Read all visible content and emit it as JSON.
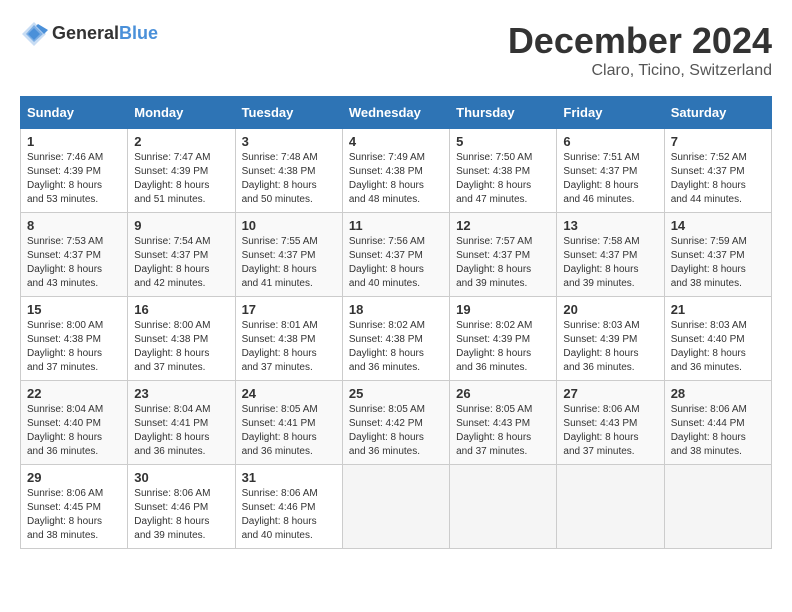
{
  "logo": {
    "general": "General",
    "blue": "Blue"
  },
  "title": "December 2024",
  "location": "Claro, Ticino, Switzerland",
  "days_header": [
    "Sunday",
    "Monday",
    "Tuesday",
    "Wednesday",
    "Thursday",
    "Friday",
    "Saturday"
  ],
  "weeks": [
    [
      {
        "num": "1",
        "sunrise": "7:46 AM",
        "sunset": "4:39 PM",
        "daylight": "8 hours and 53 minutes."
      },
      {
        "num": "2",
        "sunrise": "7:47 AM",
        "sunset": "4:39 PM",
        "daylight": "8 hours and 51 minutes."
      },
      {
        "num": "3",
        "sunrise": "7:48 AM",
        "sunset": "4:38 PM",
        "daylight": "8 hours and 50 minutes."
      },
      {
        "num": "4",
        "sunrise": "7:49 AM",
        "sunset": "4:38 PM",
        "daylight": "8 hours and 48 minutes."
      },
      {
        "num": "5",
        "sunrise": "7:50 AM",
        "sunset": "4:38 PM",
        "daylight": "8 hours and 47 minutes."
      },
      {
        "num": "6",
        "sunrise": "7:51 AM",
        "sunset": "4:37 PM",
        "daylight": "8 hours and 46 minutes."
      },
      {
        "num": "7",
        "sunrise": "7:52 AM",
        "sunset": "4:37 PM",
        "daylight": "8 hours and 44 minutes."
      }
    ],
    [
      {
        "num": "8",
        "sunrise": "7:53 AM",
        "sunset": "4:37 PM",
        "daylight": "8 hours and 43 minutes."
      },
      {
        "num": "9",
        "sunrise": "7:54 AM",
        "sunset": "4:37 PM",
        "daylight": "8 hours and 42 minutes."
      },
      {
        "num": "10",
        "sunrise": "7:55 AM",
        "sunset": "4:37 PM",
        "daylight": "8 hours and 41 minutes."
      },
      {
        "num": "11",
        "sunrise": "7:56 AM",
        "sunset": "4:37 PM",
        "daylight": "8 hours and 40 minutes."
      },
      {
        "num": "12",
        "sunrise": "7:57 AM",
        "sunset": "4:37 PM",
        "daylight": "8 hours and 39 minutes."
      },
      {
        "num": "13",
        "sunrise": "7:58 AM",
        "sunset": "4:37 PM",
        "daylight": "8 hours and 39 minutes."
      },
      {
        "num": "14",
        "sunrise": "7:59 AM",
        "sunset": "4:37 PM",
        "daylight": "8 hours and 38 minutes."
      }
    ],
    [
      {
        "num": "15",
        "sunrise": "8:00 AM",
        "sunset": "4:38 PM",
        "daylight": "8 hours and 37 minutes."
      },
      {
        "num": "16",
        "sunrise": "8:00 AM",
        "sunset": "4:38 PM",
        "daylight": "8 hours and 37 minutes."
      },
      {
        "num": "17",
        "sunrise": "8:01 AM",
        "sunset": "4:38 PM",
        "daylight": "8 hours and 37 minutes."
      },
      {
        "num": "18",
        "sunrise": "8:02 AM",
        "sunset": "4:38 PM",
        "daylight": "8 hours and 36 minutes."
      },
      {
        "num": "19",
        "sunrise": "8:02 AM",
        "sunset": "4:39 PM",
        "daylight": "8 hours and 36 minutes."
      },
      {
        "num": "20",
        "sunrise": "8:03 AM",
        "sunset": "4:39 PM",
        "daylight": "8 hours and 36 minutes."
      },
      {
        "num": "21",
        "sunrise": "8:03 AM",
        "sunset": "4:40 PM",
        "daylight": "8 hours and 36 minutes."
      }
    ],
    [
      {
        "num": "22",
        "sunrise": "8:04 AM",
        "sunset": "4:40 PM",
        "daylight": "8 hours and 36 minutes."
      },
      {
        "num": "23",
        "sunrise": "8:04 AM",
        "sunset": "4:41 PM",
        "daylight": "8 hours and 36 minutes."
      },
      {
        "num": "24",
        "sunrise": "8:05 AM",
        "sunset": "4:41 PM",
        "daylight": "8 hours and 36 minutes."
      },
      {
        "num": "25",
        "sunrise": "8:05 AM",
        "sunset": "4:42 PM",
        "daylight": "8 hours and 36 minutes."
      },
      {
        "num": "26",
        "sunrise": "8:05 AM",
        "sunset": "4:43 PM",
        "daylight": "8 hours and 37 minutes."
      },
      {
        "num": "27",
        "sunrise": "8:06 AM",
        "sunset": "4:43 PM",
        "daylight": "8 hours and 37 minutes."
      },
      {
        "num": "28",
        "sunrise": "8:06 AM",
        "sunset": "4:44 PM",
        "daylight": "8 hours and 38 minutes."
      }
    ],
    [
      {
        "num": "29",
        "sunrise": "8:06 AM",
        "sunset": "4:45 PM",
        "daylight": "8 hours and 38 minutes."
      },
      {
        "num": "30",
        "sunrise": "8:06 AM",
        "sunset": "4:46 PM",
        "daylight": "8 hours and 39 minutes."
      },
      {
        "num": "31",
        "sunrise": "8:06 AM",
        "sunset": "4:46 PM",
        "daylight": "8 hours and 40 minutes."
      },
      null,
      null,
      null,
      null
    ]
  ]
}
